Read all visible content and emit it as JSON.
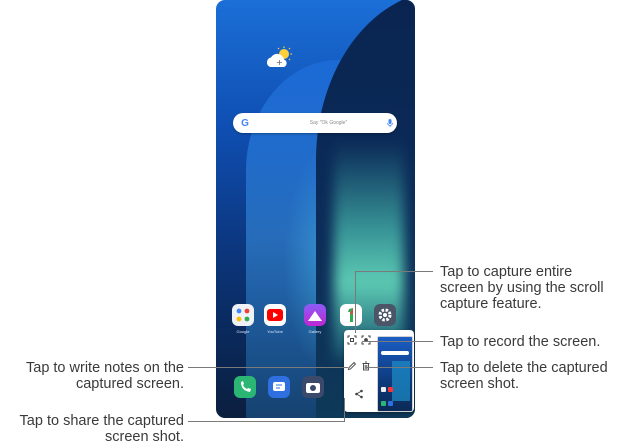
{
  "phone": {
    "search_placeholder": "Say \"Ok Google\"",
    "search_logo": "G",
    "apps": [
      {
        "name": "Google",
        "label": "Google"
      },
      {
        "name": "YouTube",
        "label": "YouTube"
      },
      {
        "name": "Gallery",
        "label": "Gallery"
      },
      {
        "name": "Google One",
        "label": ""
      },
      {
        "name": "Settings",
        "label": ""
      }
    ],
    "dock": [
      "phone-icon",
      "messages-icon",
      "camera-icon"
    ]
  },
  "popup_icons": [
    "scroll-capture-icon",
    "record-icon",
    "edit-icon",
    "delete-icon",
    "share-icon"
  ],
  "callouts": {
    "scroll_capture": [
      "Tap to capture entire",
      "screen by using the scroll",
      "capture feature."
    ],
    "record": "Tap to record the screen.",
    "delete": [
      "Tap to delete the captured",
      "screen shot."
    ],
    "write_notes": [
      "Tap to write notes on the",
      "captured screen."
    ],
    "share": [
      "Tap to share the captured",
      "screen shot."
    ]
  },
  "colors": {
    "line": "#7a7a7a",
    "text": "#3a3a3a",
    "wallpaper_top": "#1b6fd7"
  }
}
